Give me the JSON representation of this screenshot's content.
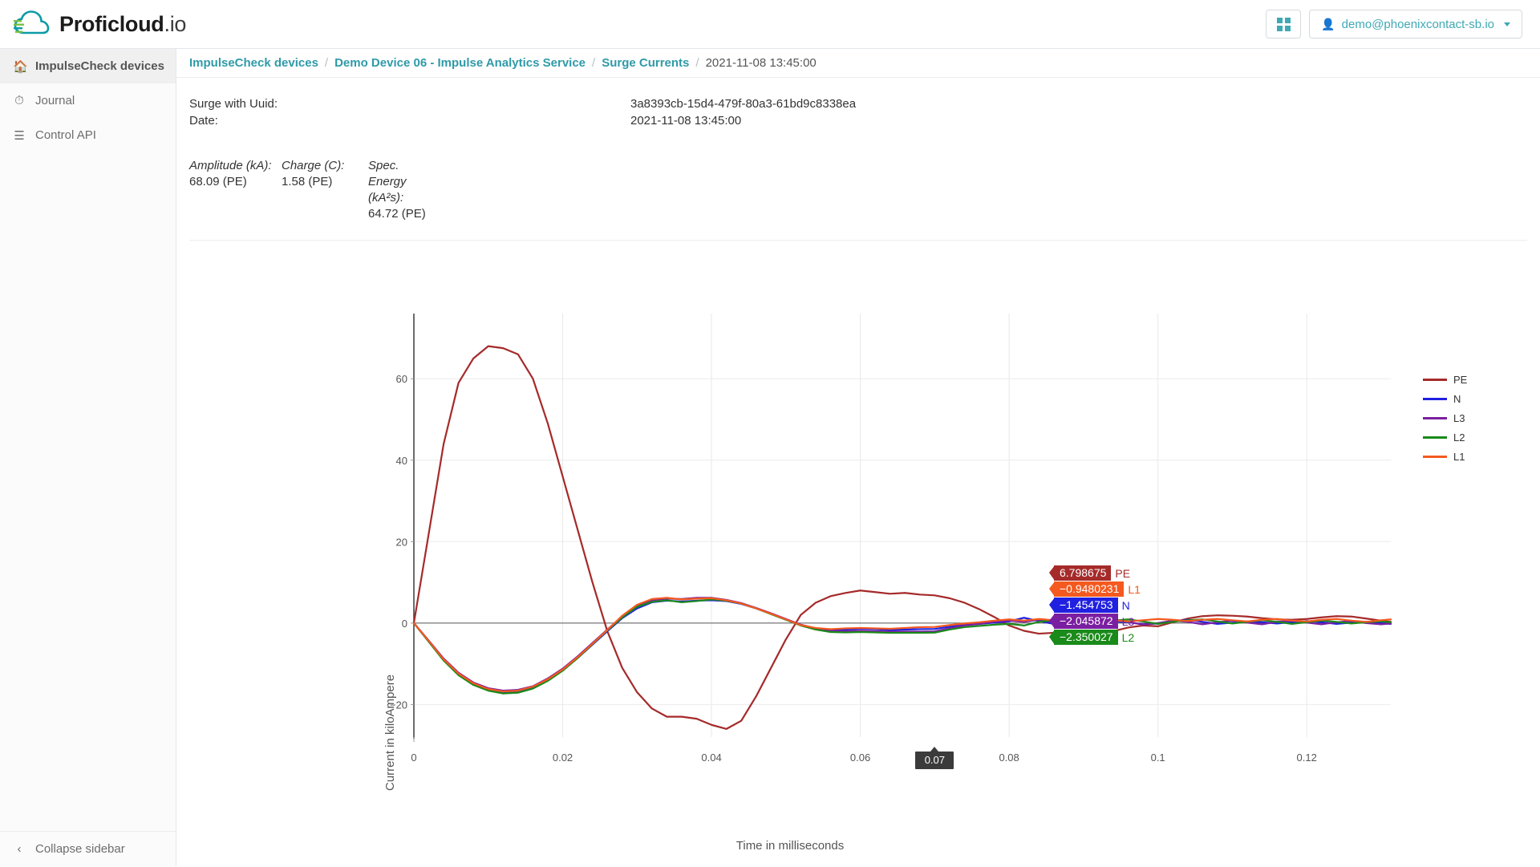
{
  "header": {
    "brand_main": "Proficloud",
    "brand_suffix": ".io",
    "brand_logo_icon": "cloud-icon",
    "apps_button_icon": "grid-apps-icon",
    "user_icon": "user-icon",
    "user_email": "demo@phoenixcontact-sb.io",
    "caret_icon": "chevron-down-icon",
    "accent_color": "#3fa9b5"
  },
  "sidebar": {
    "items": [
      {
        "label": "ImpulseCheck devices",
        "icon": "home-icon",
        "active": true
      },
      {
        "label": "Journal",
        "icon": "clock-icon",
        "active": false
      },
      {
        "label": "Control API",
        "icon": "list-icon",
        "active": false
      }
    ],
    "collapse": {
      "label": "Collapse sidebar",
      "icon": "chevron-left-icon"
    }
  },
  "breadcrumb": {
    "items": [
      "ImpulseCheck devices",
      "Demo Device 06 - Impulse Analytics Service",
      "Surge Currents"
    ],
    "current": "2021-11-08 13:45:00",
    "separator": "/"
  },
  "details": {
    "uuid_label": "Surge with Uuid:",
    "uuid_value": "3a8393cb-15d4-479f-80a3-61bd9c8338ea",
    "date_label": "Date:",
    "date_value": "2021-11-08 13:45:00"
  },
  "metrics": [
    {
      "label": "Amplitude (kA):",
      "value": "68.09 (PE)"
    },
    {
      "label": "Charge (C):",
      "value": "1.58 (PE)"
    },
    {
      "label": "Spec. Energy (kA²s):",
      "value": "64.72 (PE)"
    }
  ],
  "chart_data": {
    "type": "line",
    "title": "",
    "xlabel": "Time in milliseconds",
    "ylabel": "Current in kiloAmpere",
    "xlim": [
      0,
      0.1313
    ],
    "ylim": [
      -28,
      76
    ],
    "xticks": [
      "0",
      "0.02",
      "0.04",
      "0.06",
      "0.08",
      "0.1",
      "0.12"
    ],
    "xtick_values": [
      0,
      0.02,
      0.04,
      0.06,
      0.08,
      0.1,
      0.12
    ],
    "yticks": [
      "60",
      "40",
      "20",
      "0",
      "−20"
    ],
    "ytick_values": [
      60,
      40,
      20,
      0,
      -20
    ],
    "grid": true,
    "legend_position": "right",
    "cursor_x_label": "0.07",
    "cursor_x_value": 0.07,
    "series": [
      {
        "name": "PE",
        "color": "#a52a2a",
        "tooltip_value": "6.798675",
        "x": [
          0,
          0.002,
          0.004,
          0.006,
          0.008,
          0.01,
          0.012,
          0.014,
          0.016,
          0.018,
          0.02,
          0.022,
          0.024,
          0.026,
          0.028,
          0.03,
          0.032,
          0.034,
          0.036,
          0.038,
          0.04,
          0.042,
          0.044,
          0.046,
          0.048,
          0.05,
          0.052,
          0.054,
          0.056,
          0.058,
          0.06,
          0.062,
          0.064,
          0.066,
          0.068,
          0.07,
          0.072,
          0.074,
          0.076,
          0.078,
          0.08,
          0.082,
          0.084,
          0.086,
          0.088,
          0.09,
          0.092,
          0.094,
          0.096,
          0.098,
          0.1,
          0.102,
          0.104,
          0.106,
          0.108,
          0.11,
          0.112,
          0.114,
          0.116,
          0.118,
          0.12,
          0.122,
          0.124,
          0.126,
          0.128,
          0.13,
          0.1313
        ],
        "y": [
          0,
          22,
          44,
          59,
          65,
          68,
          67.5,
          66,
          60,
          49,
          36,
          23,
          10,
          -2,
          -11,
          -17,
          -21,
          -23,
          -23,
          -23.5,
          -25,
          -26,
          -24,
          -18,
          -11,
          -4,
          2,
          5,
          6.6,
          7.4,
          8,
          7.6,
          7.2,
          7.4,
          7.0,
          6.8,
          6.1,
          5.0,
          3.4,
          1.5,
          -0.6,
          -1.9,
          -2.6,
          -2.4,
          -2.8,
          -3.4,
          -2.9,
          -2.0,
          -1.1,
          -0.6,
          -0.8,
          0.2,
          1.1,
          1.7,
          1.9,
          1.8,
          1.6,
          1.2,
          0.9,
          0.8,
          1.0,
          1.4,
          1.7,
          1.6,
          1.1,
          0.6,
          0.3
        ]
      },
      {
        "name": "N",
        "color": "#2020e0",
        "tooltip_value": "−1.454753",
        "x": [
          0,
          0.002,
          0.004,
          0.006,
          0.008,
          0.01,
          0.012,
          0.014,
          0.016,
          0.018,
          0.02,
          0.022,
          0.024,
          0.026,
          0.028,
          0.03,
          0.032,
          0.034,
          0.036,
          0.038,
          0.04,
          0.042,
          0.044,
          0.046,
          0.048,
          0.05,
          0.052,
          0.054,
          0.056,
          0.058,
          0.06,
          0.062,
          0.064,
          0.066,
          0.068,
          0.07,
          0.072,
          0.074,
          0.076,
          0.078,
          0.08,
          0.082,
          0.084,
          0.086,
          0.088,
          0.09,
          0.092,
          0.094,
          0.096,
          0.098,
          0.1,
          0.102,
          0.104,
          0.106,
          0.108,
          0.11,
          0.112,
          0.114,
          0.116,
          0.118,
          0.12,
          0.122,
          0.124,
          0.126,
          0.128,
          0.13,
          0.1313
        ],
        "y": [
          0,
          -4.5,
          -9.0,
          -12.6,
          -15.0,
          -16.4,
          -17.0,
          -16.8,
          -15.8,
          -14.0,
          -11.6,
          -8.6,
          -5.3,
          -2.0,
          1.2,
          3.6,
          5.1,
          5.5,
          5.3,
          5.5,
          5.6,
          5.4,
          4.7,
          3.6,
          2.3,
          0.9,
          -0.5,
          -1.4,
          -1.8,
          -1.6,
          -1.4,
          -1.5,
          -1.7,
          -1.6,
          -1.5,
          -1.45,
          -0.9,
          -0.4,
          -0.2,
          0.1,
          0.4,
          1.3,
          0.5,
          -0.2,
          -0.5,
          -0.3,
          0.1,
          0.4,
          0.2,
          -0.3,
          -0.1,
          0.5,
          0.8,
          0.3,
          -0.2,
          0.1,
          0.4,
          0.2,
          -0.1,
          0.2,
          0.5,
          0.2,
          -0.2,
          0.1,
          0.3,
          0.0,
          -0.2
        ]
      },
      {
        "name": "L3",
        "color": "#7b1fa2",
        "tooltip_value": "−2.045872",
        "x": [
          0,
          0.002,
          0.004,
          0.006,
          0.008,
          0.01,
          0.012,
          0.014,
          0.016,
          0.018,
          0.02,
          0.022,
          0.024,
          0.026,
          0.028,
          0.03,
          0.032,
          0.034,
          0.036,
          0.038,
          0.04,
          0.042,
          0.044,
          0.046,
          0.048,
          0.05,
          0.052,
          0.054,
          0.056,
          0.058,
          0.06,
          0.062,
          0.064,
          0.066,
          0.068,
          0.07,
          0.072,
          0.074,
          0.076,
          0.078,
          0.08,
          0.082,
          0.084,
          0.086,
          0.088,
          0.09,
          0.092,
          0.094,
          0.096,
          0.098,
          0.1,
          0.102,
          0.104,
          0.106,
          0.108,
          0.11,
          0.112,
          0.114,
          0.116,
          0.118,
          0.12,
          0.122,
          0.124,
          0.126,
          0.128,
          0.13,
          0.1313
        ],
        "y": [
          0,
          -4.3,
          -8.7,
          -12.2,
          -14.6,
          -16.0,
          -16.6,
          -16.4,
          -15.5,
          -13.6,
          -11.2,
          -8.2,
          -4.9,
          -1.6,
          1.6,
          4.2,
          5.6,
          6.0,
          5.9,
          6.2,
          6.2,
          5.7,
          4.9,
          3.7,
          2.4,
          1.0,
          -0.4,
          -1.3,
          -1.9,
          -2.0,
          -1.9,
          -2.0,
          -2.1,
          -2.1,
          -2.1,
          -2.05,
          -1.3,
          -0.6,
          -0.2,
          0.3,
          0.6,
          0.3,
          0.8,
          0.2,
          -0.4,
          -0.2,
          0.4,
          0.9,
          0.3,
          -0.4,
          0.0,
          0.6,
          0.3,
          -0.3,
          0.2,
          0.6,
          0.1,
          -0.3,
          0.3,
          0.6,
          0.1,
          -0.3,
          0.2,
          0.5,
          0.0,
          -0.3,
          -0.1
        ]
      },
      {
        "name": "L2",
        "color": "#1a8a1a",
        "tooltip_value": "−2.350027",
        "x": [
          0,
          0.002,
          0.004,
          0.006,
          0.008,
          0.01,
          0.012,
          0.014,
          0.016,
          0.018,
          0.02,
          0.022,
          0.024,
          0.026,
          0.028,
          0.03,
          0.032,
          0.034,
          0.036,
          0.038,
          0.04,
          0.042,
          0.044,
          0.046,
          0.048,
          0.05,
          0.052,
          0.054,
          0.056,
          0.058,
          0.06,
          0.062,
          0.064,
          0.066,
          0.068,
          0.07,
          0.072,
          0.074,
          0.076,
          0.078,
          0.08,
          0.082,
          0.084,
          0.086,
          0.088,
          0.09,
          0.092,
          0.094,
          0.096,
          0.098,
          0.1,
          0.102,
          0.104,
          0.106,
          0.108,
          0.11,
          0.112,
          0.114,
          0.116,
          0.118,
          0.12,
          0.122,
          0.124,
          0.126,
          0.128,
          0.13,
          0.1313
        ],
        "y": [
          0,
          -4.6,
          -9.2,
          -12.8,
          -15.2,
          -16.6,
          -17.3,
          -17.1,
          -16.1,
          -14.2,
          -11.7,
          -8.6,
          -5.2,
          -1.8,
          1.4,
          4.0,
          5.2,
          5.6,
          5.1,
          5.4,
          5.8,
          5.5,
          4.8,
          3.6,
          2.2,
          0.8,
          -0.6,
          -1.6,
          -2.2,
          -2.3,
          -2.2,
          -2.3,
          -2.4,
          -2.4,
          -2.4,
          -2.35,
          -1.6,
          -1.0,
          -0.7,
          -0.4,
          -0.2,
          -0.6,
          0.3,
          0.7,
          0.2,
          -0.4,
          0.1,
          0.6,
          0.9,
          0.4,
          -0.2,
          0.3,
          0.7,
          0.9,
          0.4,
          -0.1,
          0.3,
          0.7,
          0.3,
          -0.2,
          0.2,
          0.6,
          0.3,
          -0.1,
          0.2,
          0.4,
          0.2
        ]
      },
      {
        "name": "L1",
        "color": "#f4591f",
        "tooltip_value": "−0.9480231",
        "x": [
          0,
          0.002,
          0.004,
          0.006,
          0.008,
          0.01,
          0.012,
          0.014,
          0.016,
          0.018,
          0.02,
          0.022,
          0.024,
          0.026,
          0.028,
          0.03,
          0.032,
          0.034,
          0.036,
          0.038,
          0.04,
          0.042,
          0.044,
          0.046,
          0.048,
          0.05,
          0.052,
          0.054,
          0.056,
          0.058,
          0.06,
          0.062,
          0.064,
          0.066,
          0.068,
          0.07,
          0.072,
          0.074,
          0.076,
          0.078,
          0.08,
          0.082,
          0.084,
          0.086,
          0.088,
          0.09,
          0.092,
          0.094,
          0.096,
          0.098,
          0.1,
          0.102,
          0.104,
          0.106,
          0.108,
          0.11,
          0.112,
          0.114,
          0.116,
          0.118,
          0.12,
          0.122,
          0.124,
          0.126,
          0.128,
          0.13,
          0.1313
        ],
        "y": [
          0,
          -4.4,
          -8.9,
          -12.4,
          -14.8,
          -16.2,
          -16.8,
          -16.6,
          -15.6,
          -13.8,
          -11.4,
          -8.4,
          -5.1,
          -1.7,
          1.8,
          4.5,
          5.9,
          6.2,
          5.8,
          6.0,
          6.1,
          5.6,
          4.8,
          3.6,
          2.3,
          0.9,
          -0.5,
          -1.2,
          -1.5,
          -1.3,
          -1.2,
          -1.3,
          -1.4,
          -1.2,
          -1.0,
          -0.95,
          -0.5,
          -0.1,
          0.2,
          0.6,
          0.9,
          0.6,
          1.0,
          0.7,
          0.3,
          0.6,
          1.0,
          0.7,
          0.4,
          0.7,
          1.0,
          0.8,
          0.5,
          0.8,
          1.0,
          0.7,
          0.4,
          0.8,
          1.0,
          0.6,
          0.4,
          0.8,
          1.0,
          0.6,
          0.3,
          0.7,
          0.9
        ]
      }
    ]
  }
}
